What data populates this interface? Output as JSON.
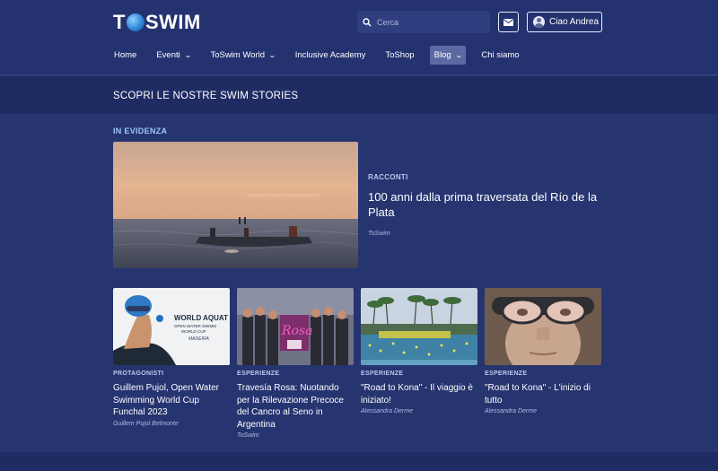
{
  "header": {
    "logo": {
      "part1": "T",
      "part2": "SWIM"
    },
    "search": {
      "placeholder": "Cerca"
    },
    "user": {
      "greeting": "Ciao Andrea"
    }
  },
  "nav": {
    "items": [
      {
        "label": "Home",
        "dropdown": false,
        "active": false
      },
      {
        "label": "Eventi",
        "dropdown": true,
        "active": false
      },
      {
        "label": "ToSwim World",
        "dropdown": true,
        "active": false
      },
      {
        "label": "Inclusive Academy",
        "dropdown": false,
        "active": false
      },
      {
        "label": "ToShop",
        "dropdown": false,
        "active": false
      },
      {
        "label": "Blog",
        "dropdown": true,
        "active": true
      },
      {
        "label": "Chi siamo",
        "dropdown": false,
        "active": false
      }
    ]
  },
  "band": {
    "title": "SCOPRI LE NOSTRE SWIM STORIES"
  },
  "featured": {
    "section_label": "IN EVIDENZA",
    "category": "RACCONTI",
    "title": "100 anni dalla prima traversata del Río de la Plata",
    "author": "ToSwim"
  },
  "cards": [
    {
      "category": "PROTAGONISTI",
      "title": "Guillem Pujol, Open Water Swimming World Cup Funchal 2023",
      "author": "Guillem Pujol Belmonte",
      "image_text": {
        "line1": "WORLD AQUAT",
        "line2": "OPEN WATER SWIMM",
        "line3": "WORLD CUP",
        "line4": "MADEIRA"
      }
    },
    {
      "category": "ESPERIENZE",
      "title": "Travesía Rosa: Nuotando per la Rilevazione Precoce del Cancro al Seno in Argentina",
      "author": "ToSwim",
      "image_text": {
        "line1": "Rosa"
      }
    },
    {
      "category": "ESPERIENZE",
      "title": "\"Road to Kona\" - Il viaggio è iniziato!",
      "author": "Alessandra Derme"
    },
    {
      "category": "ESPERIENZE",
      "title": "\"Road to Kona\" - L'inizio di tutto",
      "author": "Alessandra Derme"
    }
  ],
  "colors": {
    "background": "#263470",
    "band": "#1f2b63",
    "accent_label": "#9cc7f2",
    "active_nav": "#5c6aa3"
  }
}
